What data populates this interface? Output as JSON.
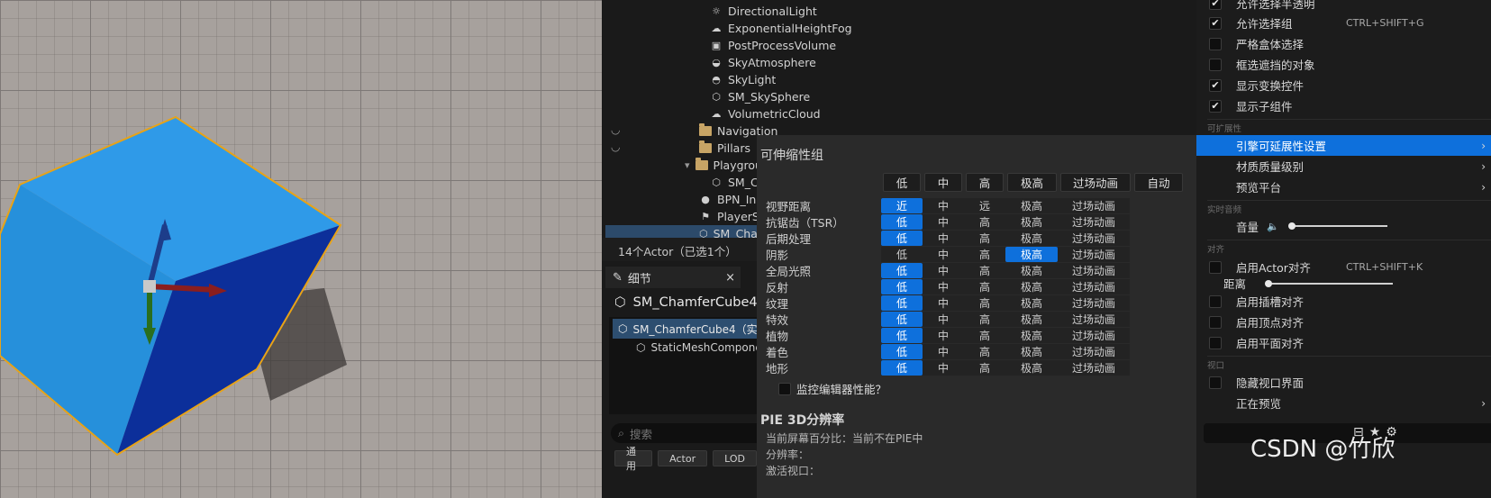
{
  "outliner": {
    "rows": [
      {
        "label": "DirectionalLight",
        "icon": "sun-icon"
      },
      {
        "label": "ExponentialHeightFog",
        "icon": "fog-icon"
      },
      {
        "label": "PostProcessVolume",
        "icon": "volume-icon"
      },
      {
        "label": "SkyAtmosphere",
        "icon": "sky-atmosphere-icon"
      },
      {
        "label": "SkyLight",
        "icon": "skylight-icon"
      },
      {
        "label": "SM_SkySphere",
        "icon": "mesh-icon"
      },
      {
        "label": "VolumetricCloud",
        "icon": "cloud-icon"
      },
      {
        "label": "Navigation",
        "icon": "folder-icon"
      },
      {
        "label": "Pillars",
        "icon": "folder-icon"
      },
      {
        "label": "Playgrou",
        "icon": "folder-open-icon"
      },
      {
        "label": "SM_Cu",
        "icon": "mesh-icon"
      },
      {
        "label": "BPN_Ins",
        "icon": "actor-icon"
      },
      {
        "label": "PlayerSt",
        "icon": "player-start-icon"
      },
      {
        "label": "SM_Cha",
        "icon": "mesh-icon"
      }
    ],
    "actor_count": "14个Actor（已选1个）"
  },
  "details": {
    "tab_label": "细节",
    "close_glyph": "×",
    "actor_name": "SM_ChamferCube4",
    "component_root": "SM_ChamferCube4（实",
    "component_child": "StaticMeshCompone",
    "search_placeholder": "搜索",
    "filters": [
      "通用",
      "Actor",
      "LOD"
    ]
  },
  "scalability": {
    "title": "可伸缩性组",
    "headers": [
      "低",
      "中",
      "高",
      "极高",
      "过场动画",
      "自动"
    ],
    "rows": [
      {
        "label": "视野距离",
        "cells": [
          "近",
          "中",
          "远",
          "极高",
          "过场动画"
        ],
        "selected": 0
      },
      {
        "label": "抗锯齿（TSR）",
        "cells": [
          "低",
          "中",
          "高",
          "极高",
          "过场动画"
        ],
        "selected": 0
      },
      {
        "label": "后期处理",
        "cells": [
          "低",
          "中",
          "高",
          "极高",
          "过场动画"
        ],
        "selected": 0
      },
      {
        "label": "阴影",
        "cells": [
          "低",
          "中",
          "高",
          "极高",
          "过场动画"
        ],
        "selected": 3
      },
      {
        "label": "全局光照",
        "cells": [
          "低",
          "中",
          "高",
          "极高",
          "过场动画"
        ],
        "selected": 0
      },
      {
        "label": "反射",
        "cells": [
          "低",
          "中",
          "高",
          "极高",
          "过场动画"
        ],
        "selected": 0
      },
      {
        "label": "纹理",
        "cells": [
          "低",
          "中",
          "高",
          "极高",
          "过场动画"
        ],
        "selected": 0
      },
      {
        "label": "特效",
        "cells": [
          "低",
          "中",
          "高",
          "极高",
          "过场动画"
        ],
        "selected": 0
      },
      {
        "label": "植物",
        "cells": [
          "低",
          "中",
          "高",
          "极高",
          "过场动画"
        ],
        "selected": 0
      },
      {
        "label": "着色",
        "cells": [
          "低",
          "中",
          "高",
          "极高",
          "过场动画"
        ],
        "selected": 0
      },
      {
        "label": "地形",
        "cells": [
          "低",
          "中",
          "高",
          "极高",
          "过场动画"
        ],
        "selected": 0
      }
    ],
    "monitor_label": "监控编辑器性能？",
    "pie_title": "PIE 3D分辨率",
    "pie_lines": [
      "当前屏幕百分比：当前不在PIE中",
      "分辨率：",
      "激活视口："
    ]
  },
  "menu": {
    "items": [
      {
        "label": "允许选择半透明",
        "checked": true
      },
      {
        "label": "允许选择组",
        "checked": true,
        "shortcut": "CTRL+SHIFT+G"
      },
      {
        "label": "严格盒体选择",
        "checked": false
      },
      {
        "label": "框选遮挡的对象",
        "checked": false
      },
      {
        "label": "显示变换控件",
        "checked": true
      },
      {
        "label": "显示子组件",
        "checked": true
      }
    ],
    "section_extensibility": "可扩展性",
    "ext_items": [
      {
        "label": "引擎可延展性设置",
        "highlighted": true
      },
      {
        "label": "材质质量级别"
      },
      {
        "label": "预览平台"
      }
    ],
    "section_audio": "实时音频",
    "volume_label": "音量",
    "volume_level": 0.0,
    "section_snap": "对齐",
    "snap_actor": {
      "label": "启用Actor对齐",
      "shortcut": "CTRL+SHIFT+K",
      "checked": false
    },
    "distance_label": "距离",
    "distance_level": 0.0,
    "snap_items": [
      {
        "label": "启用插槽对齐",
        "checked": false
      },
      {
        "label": "启用顶点对齐",
        "checked": false
      },
      {
        "label": "启用平面对齐",
        "checked": false
      }
    ],
    "section_viewport": "视口",
    "hide_viewport_ui": {
      "label": "隐藏视口界面",
      "checked": false
    },
    "previewing": "正在预览",
    "arrow_glyph": "›",
    "check_glyph": "✔"
  },
  "watermark": "CSDN @竹欣",
  "colors": {
    "accent": "#0e70dc",
    "cube": "#2f9ae8",
    "outline": "#e8a317"
  }
}
